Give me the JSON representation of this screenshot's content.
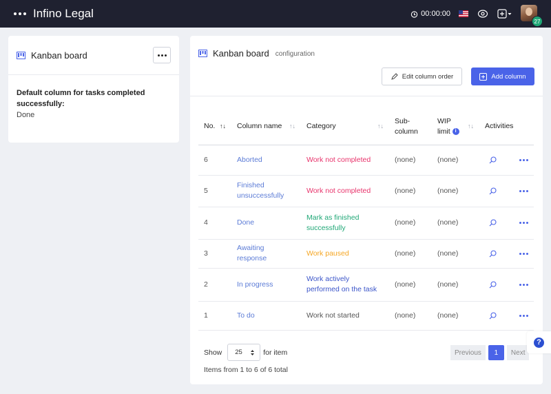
{
  "header": {
    "app_title": "Infino Legal",
    "timer": "00:00:00",
    "avatar_badge": "27"
  },
  "left_card": {
    "title": "Kanban board",
    "default_label": "Default column for tasks completed successfully:",
    "default_value": "Done"
  },
  "main": {
    "title": "Kanban board",
    "subtitle": "configuration",
    "edit_button": "Edit column order",
    "add_button": "Add column",
    "columns": {
      "no": "No.",
      "name": "Column name",
      "category": "Category",
      "sub_column": "Sub-column",
      "wip_limit": "WIP limit",
      "activities": "Activities"
    },
    "rows": [
      {
        "no": "6",
        "name": "Aborted",
        "category": "Work not completed",
        "category_color": "#e8336b",
        "sub": "(none)",
        "wip": "(none)"
      },
      {
        "no": "5",
        "name": "Finished unsuccessfully",
        "category": "Work not completed",
        "category_color": "#e8336b",
        "sub": "(none)",
        "wip": "(none)"
      },
      {
        "no": "4",
        "name": "Done",
        "category": "Mark as finished successfully",
        "category_color": "#1fa776",
        "sub": "(none)",
        "wip": "(none)"
      },
      {
        "no": "3",
        "name": "Awaiting response",
        "category": "Work paused",
        "category_color": "#f5a623",
        "sub": "(none)",
        "wip": "(none)"
      },
      {
        "no": "2",
        "name": "In progress",
        "category": "Work actively performed on the task",
        "category_color": "#3b55c9",
        "sub": "(none)",
        "wip": "(none)"
      },
      {
        "no": "1",
        "name": "To do",
        "category": "Work not started",
        "category_color": "#555555",
        "sub": "(none)",
        "wip": "(none)"
      }
    ],
    "footer": {
      "show_label": "Show",
      "page_size": "25",
      "for_item_label": "for item",
      "items_info": "Items from 1 to 6 of 6 total",
      "previous": "Previous",
      "current_page": "1",
      "next": "Next"
    }
  },
  "colors": {
    "topbar": "#1f2130",
    "accent": "#4a63e8"
  }
}
